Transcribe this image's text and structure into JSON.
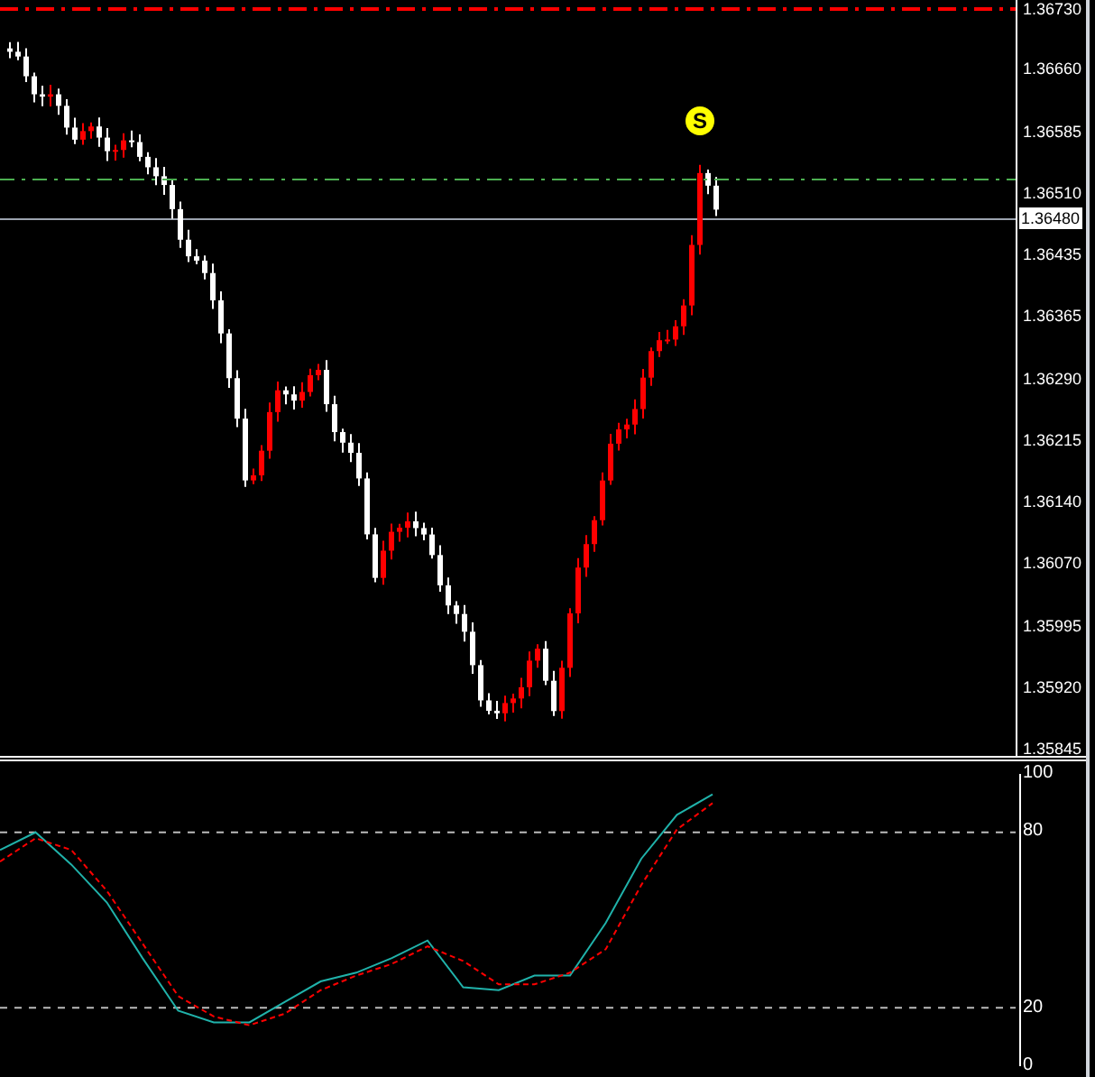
{
  "price_chart": {
    "price_labels": [
      "1.36730",
      "1.36660",
      "1.36585",
      "1.36510",
      "1.36435",
      "1.36365",
      "1.36290",
      "1.36215",
      "1.36140",
      "1.36070",
      "1.35995",
      "1.35920",
      "1.35845"
    ],
    "current_price": "1.36480",
    "signal_marker": "S"
  },
  "oscillator": {
    "chart_data": {
      "type": "line",
      "ylim": [
        0,
        100
      ],
      "yticks": [
        0,
        20,
        80,
        100
      ],
      "series": [
        {
          "color": "#20b2aa",
          "line_style": "solid",
          "values": [
            74,
            80,
            69,
            56,
            37,
            19,
            15,
            15,
            22,
            29,
            32,
            37,
            43,
            27,
            26,
            31,
            31,
            49,
            71,
            86,
            93
          ]
        },
        {
          "color": "#ff0000",
          "line_style": "dashed",
          "values": [
            70,
            78,
            74,
            60,
            42,
            24,
            17,
            14,
            18,
            26,
            31,
            35,
            41,
            36,
            28,
            28,
            32,
            40,
            62,
            81,
            90
          ]
        }
      ]
    }
  }
}
